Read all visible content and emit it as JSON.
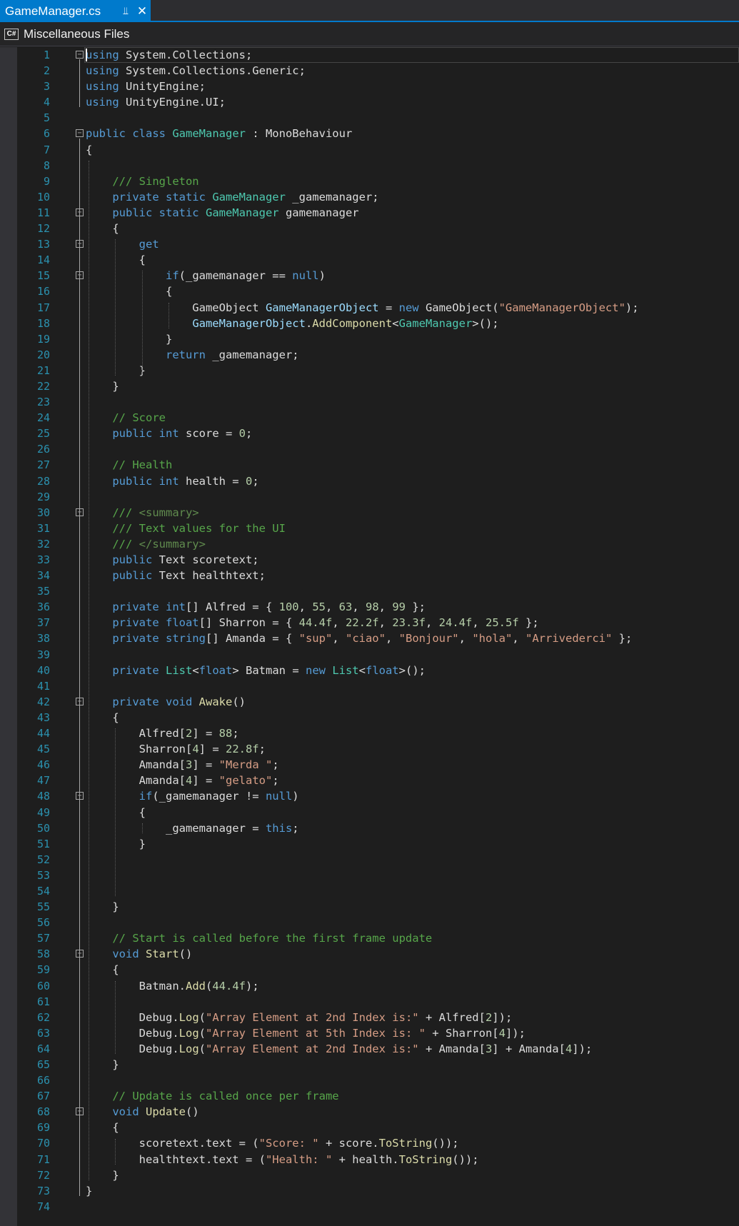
{
  "tab": {
    "title": "GameManager.cs",
    "pin_icon": "pin-icon",
    "close_icon": "close-icon"
  },
  "navbar": {
    "icon_label": "C#",
    "project_label": "Miscellaneous Files"
  },
  "colors": {
    "keyword": "#569cd6",
    "type": "#4ec9b0",
    "string": "#d69d85",
    "comment": "#57a64a",
    "xml_doc": "#608b4e",
    "number": "#b5cea8",
    "method": "#dcdcaa",
    "identifier": "#9cdcfe",
    "text": "#dcdcdc",
    "line_number": "#2b91af",
    "background": "#1e1e1e",
    "accent": "#007acc"
  },
  "code_lines": [
    [
      [
        "kw",
        "using"
      ],
      [
        "plain",
        " System.Collections;"
      ]
    ],
    [
      [
        "kw",
        "using"
      ],
      [
        "plain",
        " System.Collections.Generic;"
      ]
    ],
    [
      [
        "kw",
        "using"
      ],
      [
        "plain",
        " UnityEngine;"
      ]
    ],
    [
      [
        "kw",
        "using"
      ],
      [
        "plain",
        " UnityEngine.UI;"
      ]
    ],
    [],
    [
      [
        "kw",
        "public class "
      ],
      [
        "type",
        "GameManager"
      ],
      [
        "plain",
        " : MonoBehaviour"
      ]
    ],
    [
      [
        "plain",
        "{"
      ]
    ],
    [],
    [
      [
        "plain",
        "    "
      ],
      [
        "com",
        "/// Singleton"
      ]
    ],
    [
      [
        "plain",
        "    "
      ],
      [
        "kw",
        "private static "
      ],
      [
        "type",
        "GameManager"
      ],
      [
        "plain",
        " _gamemanager;"
      ]
    ],
    [
      [
        "plain",
        "    "
      ],
      [
        "kw",
        "public static "
      ],
      [
        "type",
        "GameManager"
      ],
      [
        "plain",
        " gamemanager"
      ]
    ],
    [
      [
        "plain",
        "    {"
      ]
    ],
    [
      [
        "plain",
        "        "
      ],
      [
        "kw",
        "get"
      ]
    ],
    [
      [
        "plain",
        "        {"
      ]
    ],
    [
      [
        "plain",
        "            "
      ],
      [
        "kw",
        "if"
      ],
      [
        "plain",
        "(_gamemanager == "
      ],
      [
        "kw",
        "null"
      ],
      [
        "plain",
        ")"
      ]
    ],
    [
      [
        "plain",
        "            {"
      ]
    ],
    [
      [
        "plain",
        "                GameObject "
      ],
      [
        "var",
        "GameManagerObject"
      ],
      [
        "plain",
        " = "
      ],
      [
        "kw",
        "new"
      ],
      [
        "plain",
        " GameObject("
      ],
      [
        "str",
        "\"GameManagerObject\""
      ],
      [
        "plain",
        ");"
      ]
    ],
    [
      [
        "plain",
        "                "
      ],
      [
        "var",
        "GameManagerObject"
      ],
      [
        "plain",
        "."
      ],
      [
        "fn",
        "AddComponent"
      ],
      [
        "plain",
        "<"
      ],
      [
        "type",
        "GameManager"
      ],
      [
        "plain",
        ">();"
      ]
    ],
    [
      [
        "plain",
        "            }"
      ]
    ],
    [
      [
        "plain",
        "            "
      ],
      [
        "kw",
        "return"
      ],
      [
        "plain",
        " _gamemanager;"
      ]
    ],
    [
      [
        "plain",
        "        }"
      ]
    ],
    [
      [
        "plain",
        "    }"
      ]
    ],
    [],
    [
      [
        "plain",
        "    "
      ],
      [
        "com",
        "// Score"
      ]
    ],
    [
      [
        "plain",
        "    "
      ],
      [
        "kw",
        "public int"
      ],
      [
        "plain",
        " score = "
      ],
      [
        "num",
        "0"
      ],
      [
        "plain",
        ";"
      ]
    ],
    [],
    [
      [
        "plain",
        "    "
      ],
      [
        "com",
        "// Health"
      ]
    ],
    [
      [
        "plain",
        "    "
      ],
      [
        "kw",
        "public int"
      ],
      [
        "plain",
        " health = "
      ],
      [
        "num",
        "0"
      ],
      [
        "plain",
        ";"
      ]
    ],
    [],
    [
      [
        "plain",
        "    "
      ],
      [
        "com",
        "/// "
      ],
      [
        "xml",
        "<summary>"
      ]
    ],
    [
      [
        "plain",
        "    "
      ],
      [
        "com",
        "/// Text values for the UI"
      ]
    ],
    [
      [
        "plain",
        "    "
      ],
      [
        "com",
        "/// "
      ],
      [
        "xml",
        "</summary>"
      ]
    ],
    [
      [
        "plain",
        "    "
      ],
      [
        "kw",
        "public"
      ],
      [
        "plain",
        " Text scoretext;"
      ]
    ],
    [
      [
        "plain",
        "    "
      ],
      [
        "kw",
        "public"
      ],
      [
        "plain",
        " Text healthtext;"
      ]
    ],
    [],
    [
      [
        "plain",
        "    "
      ],
      [
        "kw",
        "private int"
      ],
      [
        "plain",
        "[] Alfred = { "
      ],
      [
        "num",
        "100"
      ],
      [
        "plain",
        ", "
      ],
      [
        "num",
        "55"
      ],
      [
        "plain",
        ", "
      ],
      [
        "num",
        "63"
      ],
      [
        "plain",
        ", "
      ],
      [
        "num",
        "98"
      ],
      [
        "plain",
        ", "
      ],
      [
        "num",
        "99"
      ],
      [
        "plain",
        " };"
      ]
    ],
    [
      [
        "plain",
        "    "
      ],
      [
        "kw",
        "private float"
      ],
      [
        "plain",
        "[] Sharron = { "
      ],
      [
        "num",
        "44.4f"
      ],
      [
        "plain",
        ", "
      ],
      [
        "num",
        "22.2f"
      ],
      [
        "plain",
        ", "
      ],
      [
        "num",
        "23.3f"
      ],
      [
        "plain",
        ", "
      ],
      [
        "num",
        "24.4f"
      ],
      [
        "plain",
        ", "
      ],
      [
        "num",
        "25.5f"
      ],
      [
        "plain",
        " };"
      ]
    ],
    [
      [
        "plain",
        "    "
      ],
      [
        "kw",
        "private string"
      ],
      [
        "plain",
        "[] Amanda = { "
      ],
      [
        "str",
        "\"sup\""
      ],
      [
        "plain",
        ", "
      ],
      [
        "str",
        "\"ciao\""
      ],
      [
        "plain",
        ", "
      ],
      [
        "str",
        "\"Bonjour\""
      ],
      [
        "plain",
        ", "
      ],
      [
        "str",
        "\"hola\""
      ],
      [
        "plain",
        ", "
      ],
      [
        "str",
        "\"Arrivederci\""
      ],
      [
        "plain",
        " };"
      ]
    ],
    [],
    [
      [
        "plain",
        "    "
      ],
      [
        "kw",
        "private "
      ],
      [
        "type",
        "List"
      ],
      [
        "plain",
        "<"
      ],
      [
        "kw",
        "float"
      ],
      [
        "plain",
        "> Batman = "
      ],
      [
        "kw",
        "new "
      ],
      [
        "type",
        "List"
      ],
      [
        "plain",
        "<"
      ],
      [
        "kw",
        "float"
      ],
      [
        "plain",
        ">();"
      ]
    ],
    [],
    [
      [
        "plain",
        "    "
      ],
      [
        "kw",
        "private void "
      ],
      [
        "fn",
        "Awake"
      ],
      [
        "plain",
        "()"
      ]
    ],
    [
      [
        "plain",
        "    {"
      ]
    ],
    [
      [
        "plain",
        "        Alfred["
      ],
      [
        "num",
        "2"
      ],
      [
        "plain",
        "] = "
      ],
      [
        "num",
        "88"
      ],
      [
        "plain",
        ";"
      ]
    ],
    [
      [
        "plain",
        "        Sharron["
      ],
      [
        "num",
        "4"
      ],
      [
        "plain",
        "] = "
      ],
      [
        "num",
        "22.8f"
      ],
      [
        "plain",
        ";"
      ]
    ],
    [
      [
        "plain",
        "        Amanda["
      ],
      [
        "num",
        "3"
      ],
      [
        "plain",
        "] = "
      ],
      [
        "str",
        "\"Merda \""
      ],
      [
        "plain",
        ";"
      ]
    ],
    [
      [
        "plain",
        "        Amanda["
      ],
      [
        "num",
        "4"
      ],
      [
        "plain",
        "] = "
      ],
      [
        "str",
        "\"gelato\""
      ],
      [
        "plain",
        ";"
      ]
    ],
    [
      [
        "plain",
        "        "
      ],
      [
        "kw",
        "if"
      ],
      [
        "plain",
        "(_gamemanager != "
      ],
      [
        "kw",
        "null"
      ],
      [
        "plain",
        ")"
      ]
    ],
    [
      [
        "plain",
        "        {"
      ]
    ],
    [
      [
        "plain",
        "            _gamemanager = "
      ],
      [
        "kw",
        "this"
      ],
      [
        "plain",
        ";"
      ]
    ],
    [
      [
        "plain",
        "        }"
      ]
    ],
    [],
    [],
    [],
    [
      [
        "plain",
        "    }"
      ]
    ],
    [],
    [
      [
        "plain",
        "    "
      ],
      [
        "com",
        "// Start is called before the first frame update"
      ]
    ],
    [
      [
        "plain",
        "    "
      ],
      [
        "kw",
        "void "
      ],
      [
        "fn",
        "Start"
      ],
      [
        "plain",
        "()"
      ]
    ],
    [
      [
        "plain",
        "    {"
      ]
    ],
    [
      [
        "plain",
        "        Batman."
      ],
      [
        "fn",
        "Add"
      ],
      [
        "plain",
        "("
      ],
      [
        "num",
        "44.4f"
      ],
      [
        "plain",
        ");"
      ]
    ],
    [],
    [
      [
        "plain",
        "        Debug."
      ],
      [
        "fn",
        "Log"
      ],
      [
        "plain",
        "("
      ],
      [
        "str",
        "\"Array Element at 2nd Index is:\""
      ],
      [
        "plain",
        " + Alfred["
      ],
      [
        "num",
        "2"
      ],
      [
        "plain",
        "]);"
      ]
    ],
    [
      [
        "plain",
        "        Debug."
      ],
      [
        "fn",
        "Log"
      ],
      [
        "plain",
        "("
      ],
      [
        "str",
        "\"Array Element at 5th Index is: \""
      ],
      [
        "plain",
        " + Sharron["
      ],
      [
        "num",
        "4"
      ],
      [
        "plain",
        "]);"
      ]
    ],
    [
      [
        "plain",
        "        Debug."
      ],
      [
        "fn",
        "Log"
      ],
      [
        "plain",
        "("
      ],
      [
        "str",
        "\"Array Element at 2nd Index is:\""
      ],
      [
        "plain",
        " + Amanda["
      ],
      [
        "num",
        "3"
      ],
      [
        "plain",
        "] + Amanda["
      ],
      [
        "num",
        "4"
      ],
      [
        "plain",
        "]);"
      ]
    ],
    [
      [
        "plain",
        "    }"
      ]
    ],
    [],
    [
      [
        "plain",
        "    "
      ],
      [
        "com",
        "// Update is called once per frame"
      ]
    ],
    [
      [
        "plain",
        "    "
      ],
      [
        "kw",
        "void "
      ],
      [
        "fn",
        "Update"
      ],
      [
        "plain",
        "()"
      ]
    ],
    [
      [
        "plain",
        "    {"
      ]
    ],
    [
      [
        "plain",
        "        scoretext.text = ("
      ],
      [
        "str",
        "\"Score: \""
      ],
      [
        "plain",
        " + score."
      ],
      [
        "fn",
        "ToString"
      ],
      [
        "plain",
        "());"
      ]
    ],
    [
      [
        "plain",
        "        healthtext.text = ("
      ],
      [
        "str",
        "\"Health: \""
      ],
      [
        "plain",
        " + health."
      ],
      [
        "fn",
        "ToString"
      ],
      [
        "plain",
        "());"
      ]
    ],
    [
      [
        "plain",
        "    }"
      ]
    ],
    [
      [
        "plain",
        "}"
      ]
    ],
    []
  ]
}
